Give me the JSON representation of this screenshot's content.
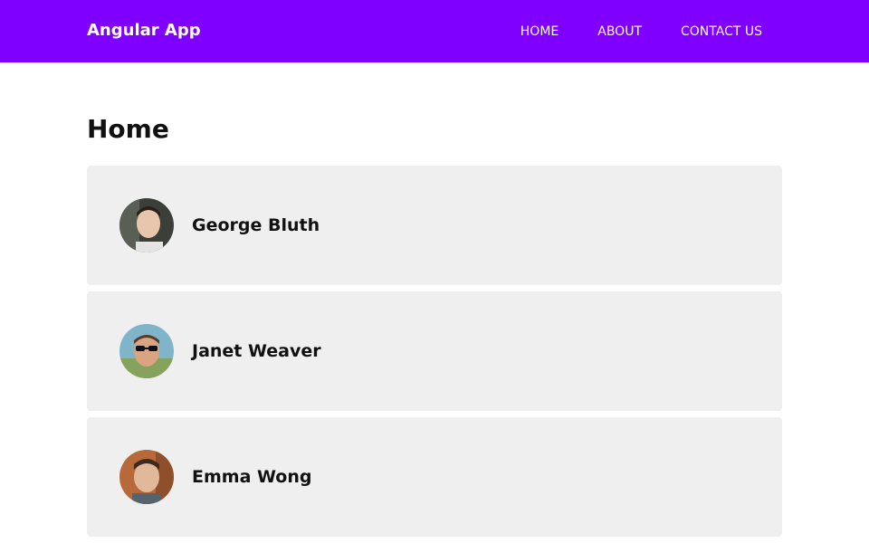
{
  "navbar": {
    "brand": "Angular App",
    "links": [
      "HOME",
      "ABOUT",
      "CONTACT US"
    ],
    "background": "#8000ff"
  },
  "main": {
    "title": "Home",
    "users": [
      {
        "name": "George Bluth",
        "avatar": "avatar-photo"
      },
      {
        "name": "Janet Weaver",
        "avatar": "avatar-photo"
      },
      {
        "name": "Emma Wong",
        "avatar": "avatar-photo"
      }
    ]
  }
}
